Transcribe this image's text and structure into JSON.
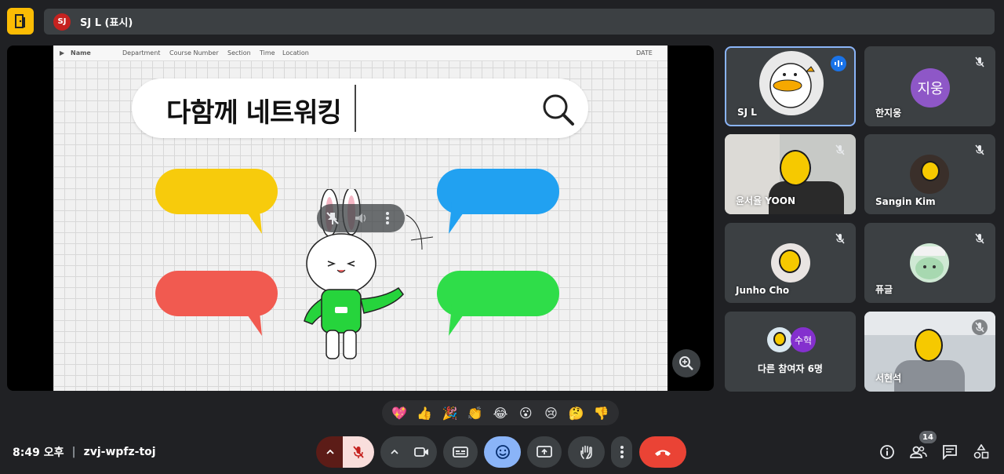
{
  "presenter": {
    "initials": "SJ",
    "label": "SJ L (표시)"
  },
  "slide": {
    "header": {
      "name": "Name",
      "department": "Department",
      "course_number": "Course Number",
      "section": "Section",
      "time": "Time",
      "location": "Location",
      "date": "DATE"
    },
    "search_text": "다함께 네트워킹",
    "bubble_colors": [
      "#f7cb0c",
      "#21a1f1",
      "#f15a50",
      "#2fdd49"
    ]
  },
  "participants": [
    {
      "name": "SJ L",
      "speaking": true
    },
    {
      "name": "한지웅",
      "avatar_text": "지웅",
      "avatar_color": "#8e57c7"
    },
    {
      "name": "윤서율 YOON"
    },
    {
      "name": "Sangin Kim"
    },
    {
      "name": "Junho Cho"
    },
    {
      "name": "퓨글"
    },
    {
      "name": "다른 참여자 6명",
      "avatar_text": "수혁",
      "avatar_color": "#8430ce"
    },
    {
      "name": "서현석"
    }
  ],
  "reactions": [
    "💖",
    "👍",
    "🎉",
    "👏",
    "😂",
    "😮",
    "😢",
    "🤔",
    "👎"
  ],
  "footer": {
    "time": "8:49 오후",
    "meeting_code": "zvj-wpfz-toj",
    "people_count": "14"
  },
  "colors": {
    "accent": "#8ab4f8",
    "end_call": "#ea4335",
    "mic_muted_bg": "#f9dedc",
    "logo": "#fbbc04"
  }
}
